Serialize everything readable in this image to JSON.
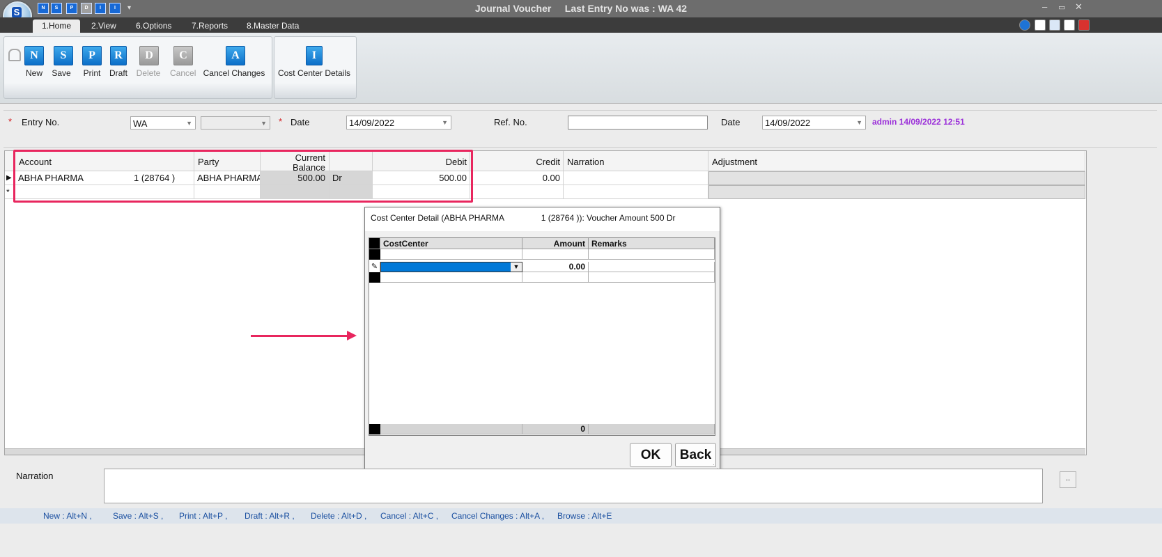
{
  "window": {
    "title": "Journal Voucher",
    "last_entry": "Last Entry No was : WA 42",
    "qat_icons": [
      "N",
      "S",
      "P",
      "D",
      "I",
      "I"
    ],
    "logo_letter": "S"
  },
  "tabs": [
    "1.Home",
    "2.View",
    "6.Options",
    "7.Reports",
    "8.Master Data"
  ],
  "ribbon": {
    "buttons": [
      {
        "label": "New",
        "icon": "N"
      },
      {
        "label": "Save",
        "icon": "S"
      },
      {
        "label": "Print",
        "icon": "P"
      },
      {
        "label": "Draft",
        "icon": "R"
      },
      {
        "label": "Delete",
        "icon": "D"
      },
      {
        "label": "Cancel",
        "icon": "C"
      },
      {
        "label": "Cancel Changes",
        "icon": "A"
      }
    ],
    "cost_center": {
      "label": "Cost Center Details",
      "icon": "I"
    }
  },
  "form": {
    "entry_label": "Entry No.",
    "entry_prefix": "WA",
    "entry_number": "",
    "date_label": "Date",
    "date_value": "14/09/2022",
    "ref_label": "Ref. No.",
    "ref_value": "",
    "date2_label": "Date",
    "date2_value": "14/09/2022",
    "audit": "admin 14/09/2022 12:51"
  },
  "grid": {
    "headers": {
      "account": "Account",
      "party": "Party",
      "current_balance": "Current Balance",
      "debit": "Debit",
      "credit": "Credit",
      "narration": "Narration",
      "adjustment": "Adjustment"
    },
    "rows": [
      {
        "account_name": "ABHA PHARMA",
        "account_code": "1 (28764 )",
        "party": "ABHA PHARMA",
        "balance": "500.00",
        "drcr": "Dr",
        "debit": "500.00",
        "credit": "0.00",
        "narration": ""
      }
    ]
  },
  "dialog": {
    "title": "Cost Center Detail (ABHA PHARMA                1 (28764 )): Voucher Amount 500 Dr",
    "headers": {
      "costcenter": "CostCenter",
      "amount": "Amount",
      "remarks": "Remarks"
    },
    "edit_row": {
      "costcenter": "",
      "amount": "0.00",
      "remarks": ""
    },
    "total": "0",
    "ok": "OK",
    "back": "Back"
  },
  "narration_label": "Narration",
  "narration_value": "",
  "ellipsis": "..",
  "shortcuts": [
    "New : Alt+N ,",
    "Save : Alt+S ,",
    "Print : Alt+P ,",
    "Draft : Alt+R ,",
    "Delete : Alt+D ,",
    "Cancel : Alt+C ,",
    "Cancel Changes : Alt+A ,",
    "Browse : Alt+E"
  ],
  "colors": {
    "highlight": "#e8265e",
    "audit_text": "#9b30d9",
    "selection": "#0078d7",
    "shortcut_text": "#1a4fa0"
  }
}
